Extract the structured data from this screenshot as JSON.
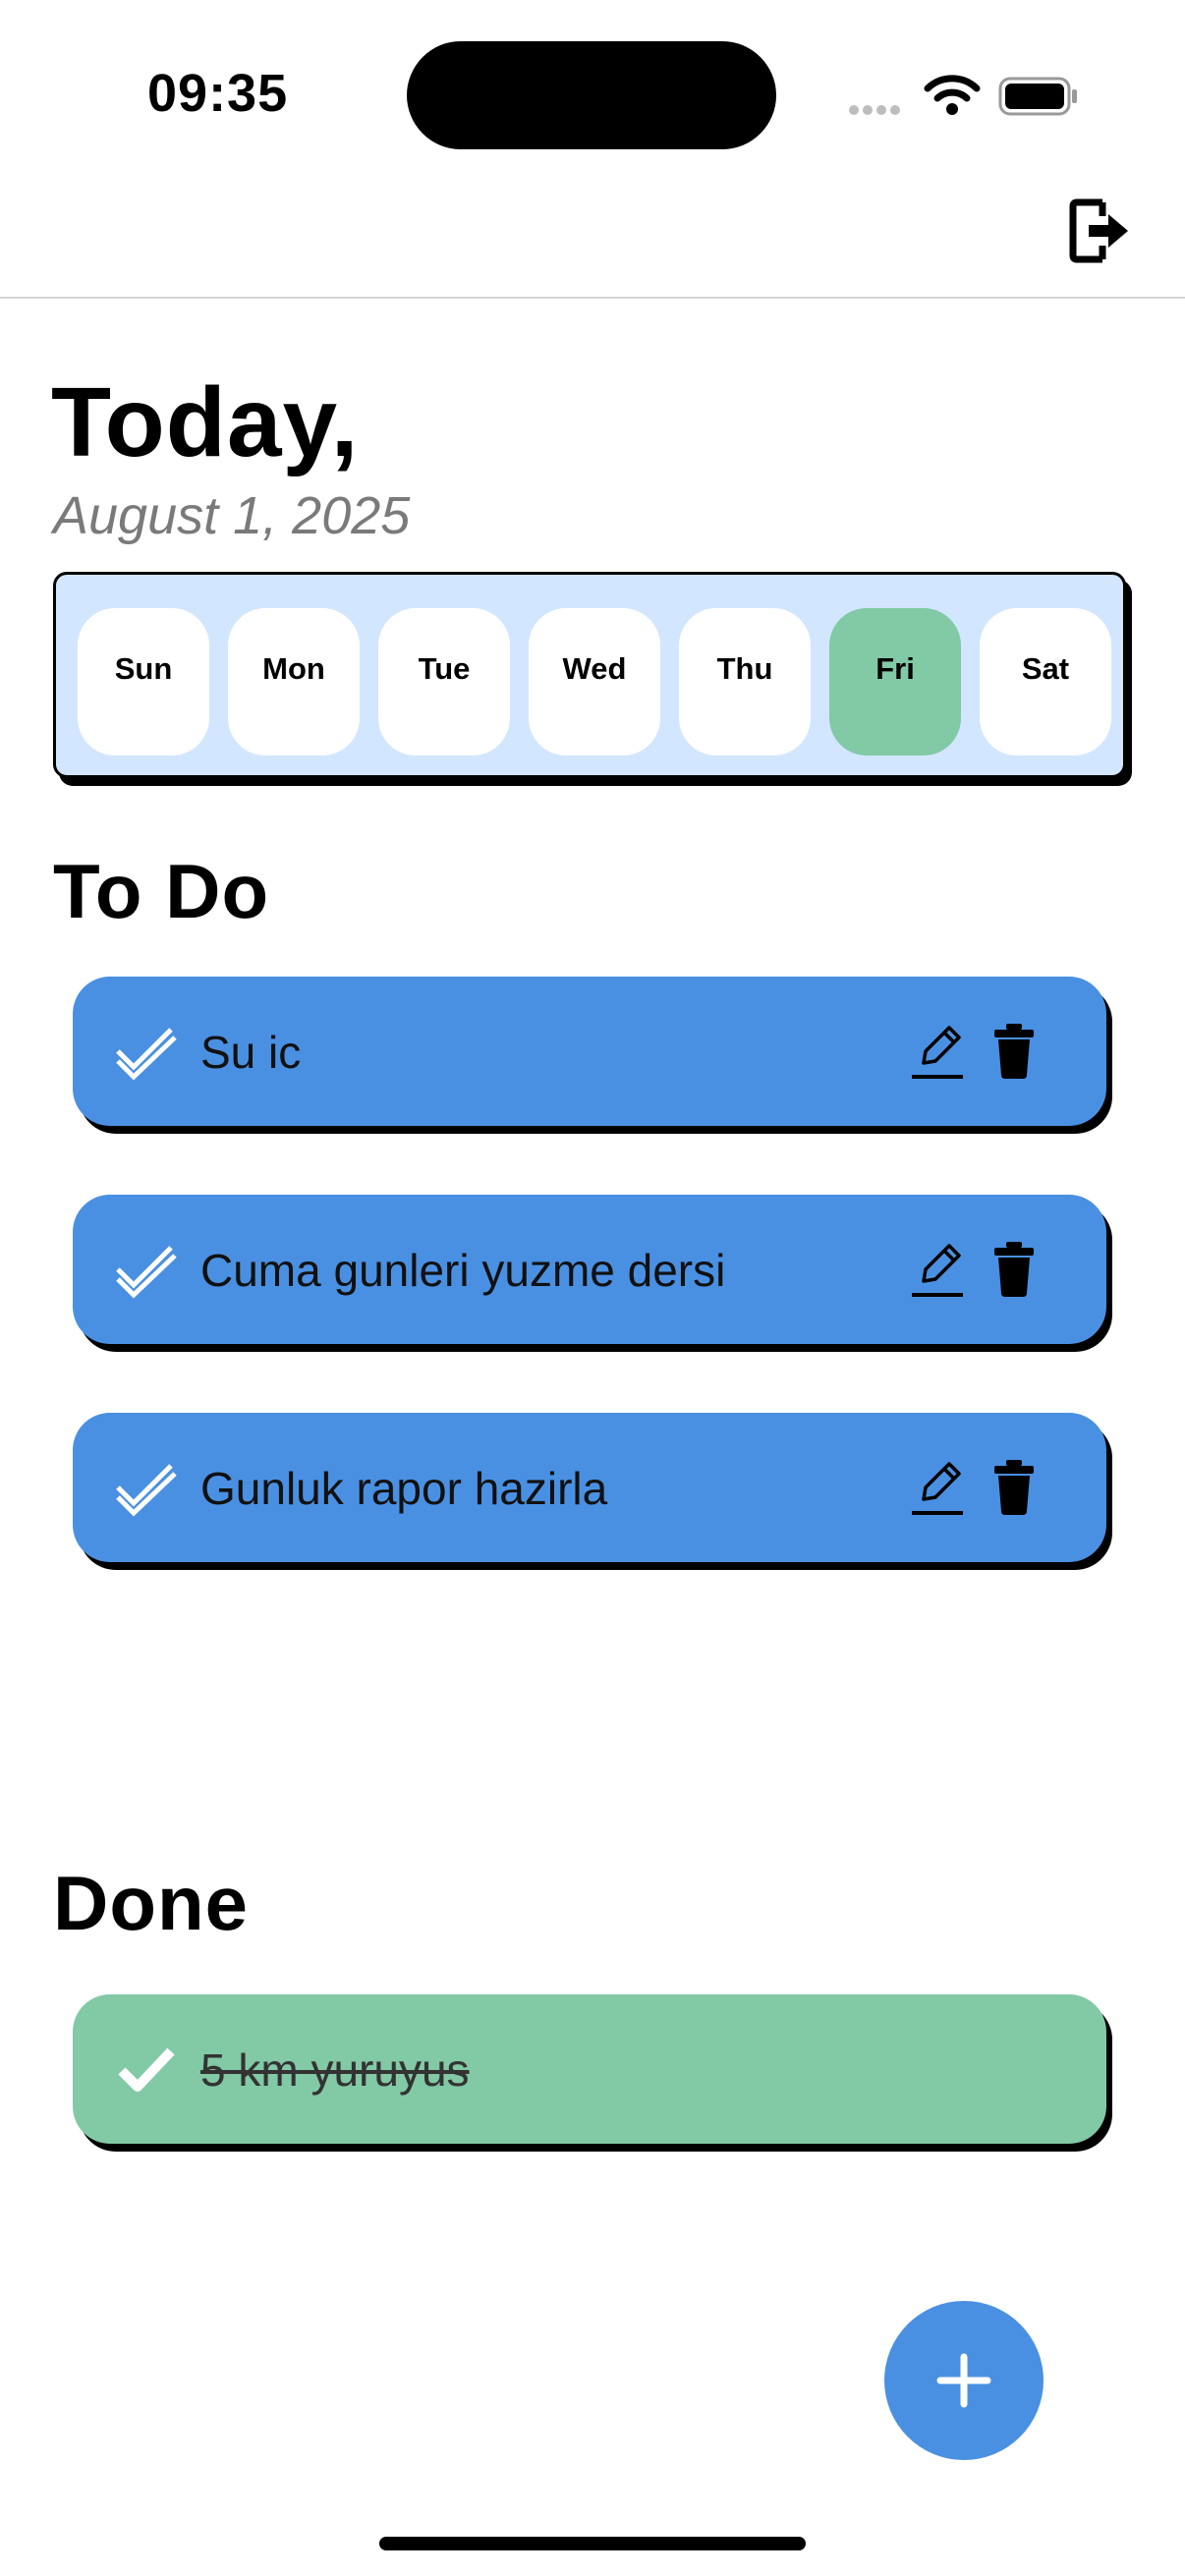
{
  "status": {
    "time": "09:35"
  },
  "header": {
    "logout_icon": "logout-icon"
  },
  "title": "Today,",
  "date": "August 1, 2025",
  "week": {
    "days": [
      "Sun",
      "Mon",
      "Tue",
      "Wed",
      "Thu",
      "Fri",
      "Sat"
    ],
    "selected": "Fri",
    "background": "#d3e6ff",
    "selected_color": "#82c9a6"
  },
  "todo": {
    "heading": "To Do",
    "items": [
      "Su ic",
      "Cuma gunleri yuzme dersi",
      "Gunluk rapor hazirla"
    ],
    "color": "#4a90e2"
  },
  "done": {
    "heading": "Done",
    "items": [
      "5 km yuruyus"
    ],
    "color": "#82c9a6"
  },
  "fab": {
    "icon": "plus-icon",
    "color": "#4a90e2"
  }
}
